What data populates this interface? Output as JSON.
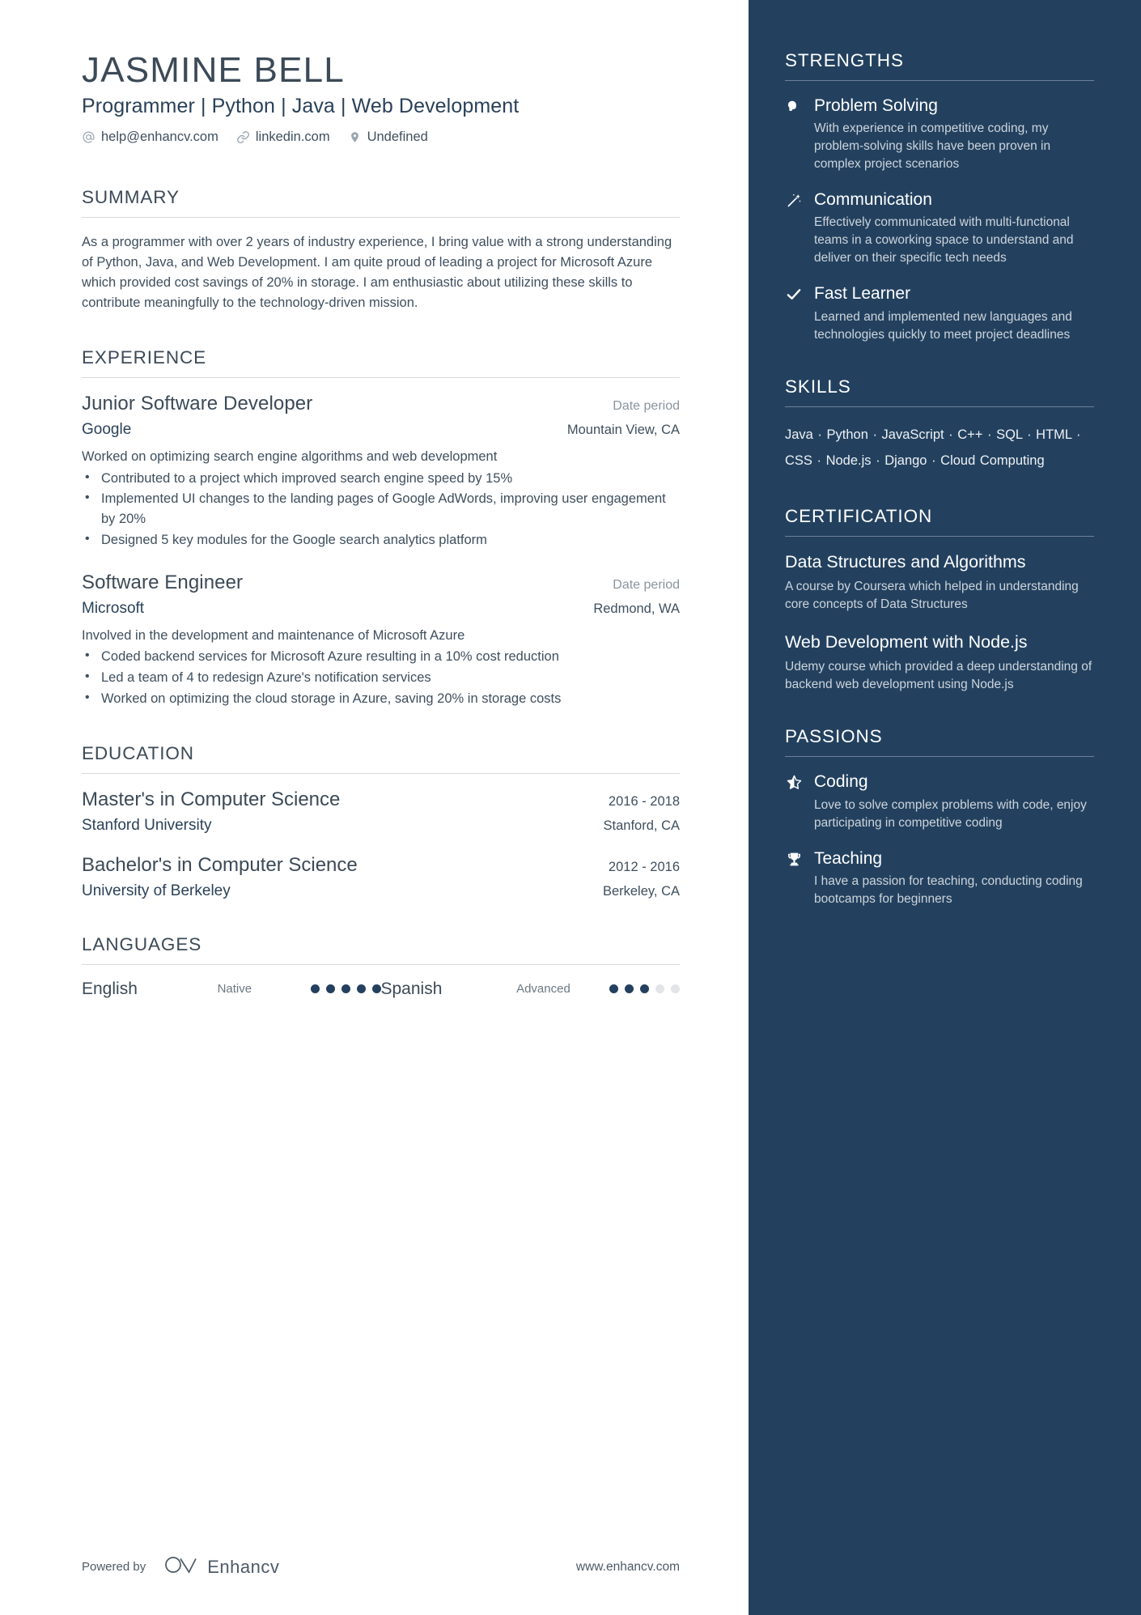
{
  "header": {
    "name": "JASMINE BELL",
    "headline": "Programmer | Python | Java | Web Development",
    "contacts": [
      {
        "icon": "at-icon",
        "text": "help@enhancv.com"
      },
      {
        "icon": "link-icon",
        "text": "linkedin.com"
      },
      {
        "icon": "location-pin-icon",
        "text": "Undefined"
      }
    ]
  },
  "summary": {
    "title": "SUMMARY",
    "text": "As a programmer with over 2 years of industry experience, I bring value with a strong understanding of Python, Java, and Web Development. I am quite proud of leading a project for Microsoft Azure which provided cost savings of 20% in storage. I am enthusiastic about utilizing these skills to contribute meaningfully to the technology-driven mission."
  },
  "experience": {
    "title": "EXPERIENCE",
    "entries": [
      {
        "role": "Junior Software Developer",
        "date": "Date period",
        "company": "Google",
        "location": "Mountain View, CA",
        "description": "Worked on optimizing search engine algorithms and web development",
        "bullets": [
          "Contributed to a project which improved search engine speed by 15%",
          "Implemented UI changes to the landing pages of Google AdWords, improving user engagement by 20%",
          "Designed 5 key modules for the Google search analytics platform"
        ]
      },
      {
        "role": "Software Engineer",
        "date": "Date period",
        "company": "Microsoft",
        "location": "Redmond, WA",
        "description": "Involved in the development and maintenance of Microsoft Azure",
        "bullets": [
          "Coded backend services for Microsoft Azure resulting in a 10% cost reduction",
          "Led a team of 4 to redesign Azure's notification services",
          "Worked on optimizing the cloud storage in Azure, saving 20% in storage costs"
        ]
      }
    ]
  },
  "education": {
    "title": "EDUCATION",
    "entries": [
      {
        "degree": "Master's in Computer Science",
        "date": "2016 - 2018",
        "school": "Stanford University",
        "location": "Stanford, CA"
      },
      {
        "degree": "Bachelor's in Computer Science",
        "date": "2012 - 2016",
        "school": "University of Berkeley",
        "location": "Berkeley, CA"
      }
    ]
  },
  "languages": {
    "title": "LANGUAGES",
    "items": [
      {
        "name": "English",
        "level": "Native",
        "filled": 5,
        "total": 5
      },
      {
        "name": "Spanish",
        "level": "Advanced",
        "filled": 3,
        "total": 5
      }
    ]
  },
  "footer": {
    "powered_by": "Powered by",
    "brand": "Enhancv",
    "brand_icon": "enhancv-logo-icon",
    "website": "www.enhancv.com"
  },
  "sidebar": {
    "strengths": {
      "title": "STRENGTHS",
      "items": [
        {
          "icon": "lightbulb-head-icon",
          "name": "Problem Solving",
          "description": "With experience in competitive coding, my problem-solving skills have been proven in complex project scenarios"
        },
        {
          "icon": "magic-wand-icon",
          "name": "Communication",
          "description": "Effectively communicated with multi-functional teams in a coworking space to understand and deliver on their specific tech needs"
        },
        {
          "icon": "checkmark-icon",
          "name": "Fast Learner",
          "description": "Learned and implemented new languages and technologies quickly to meet project deadlines"
        }
      ]
    },
    "skills": {
      "title": "SKILLS",
      "list": [
        "Java",
        "Python",
        "JavaScript",
        "C++",
        "SQL",
        "HTML",
        "CSS",
        "Node.js",
        "Django",
        "Cloud Computing"
      ],
      "text": "Java · Python · JavaScript · C++ · SQL · HTML · CSS · Node.js · Django · Cloud Computing"
    },
    "certification": {
      "title": "CERTIFICATION",
      "items": [
        {
          "name": "Data Structures and Algorithms",
          "description": "A course by Coursera which helped in understanding core concepts of Data Structures"
        },
        {
          "name": "Web Development with Node.js",
          "description": "Udemy course which provided a deep understanding of backend web development using Node.js"
        }
      ]
    },
    "passions": {
      "title": "PASSIONS",
      "items": [
        {
          "icon": "star-half-icon",
          "name": "Coding",
          "description": "Love to solve complex problems with code, enjoy participating in competitive coding"
        },
        {
          "icon": "trophy-icon",
          "name": "Teaching",
          "description": "I have a passion for teaching, conducting coding bootcamps for beginners"
        }
      ]
    }
  },
  "colors": {
    "sidebar_bg": "#23415f",
    "heading": "#3c4a57",
    "accent": "#2a4158",
    "body_text": "#3f4f5e",
    "muted": "#8a949e"
  }
}
